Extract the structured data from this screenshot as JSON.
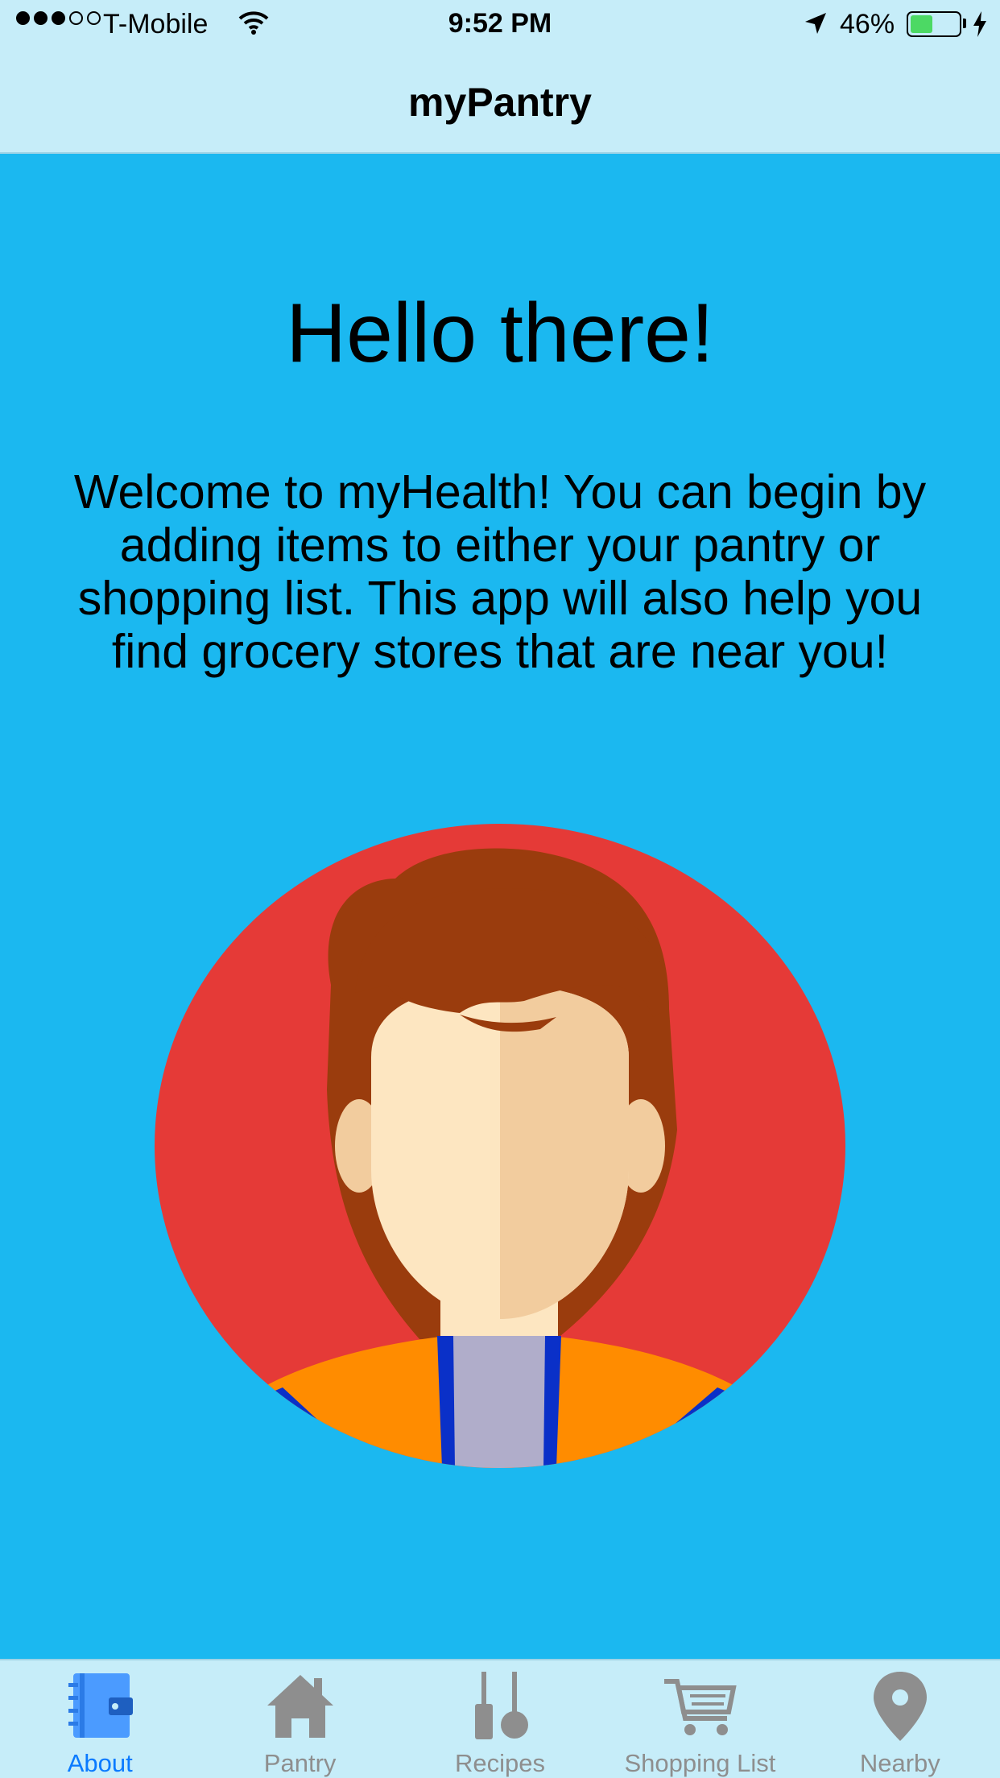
{
  "status_bar": {
    "carrier": "T-Mobile",
    "signal_bars": 3,
    "signal_total": 5,
    "time": "9:52 PM",
    "battery_percent_label": "46%",
    "battery_level": 0.46
  },
  "nav": {
    "title": "myPantry"
  },
  "main": {
    "headline": "Hello there!",
    "intro": "Welcome to myHealth! You can begin by adding items to either your pantry or shopping list. This app will also help you find grocery stores that are near you!"
  },
  "tabs": [
    {
      "label": "About",
      "icon": "notebook-icon",
      "active": true
    },
    {
      "label": "Pantry",
      "icon": "home-icon",
      "active": false
    },
    {
      "label": "Recipes",
      "icon": "utensils-icon",
      "active": false
    },
    {
      "label": "Shopping List",
      "icon": "cart-icon",
      "active": false
    },
    {
      "label": "Nearby",
      "icon": "location-pin-icon",
      "active": false
    }
  ],
  "colors": {
    "background": "#1bb8f0",
    "bars": "#c6edf9",
    "avatar_circle": "#e53a37",
    "active_tab": "#0a7aff",
    "inactive_tab": "#8e8e8e"
  }
}
